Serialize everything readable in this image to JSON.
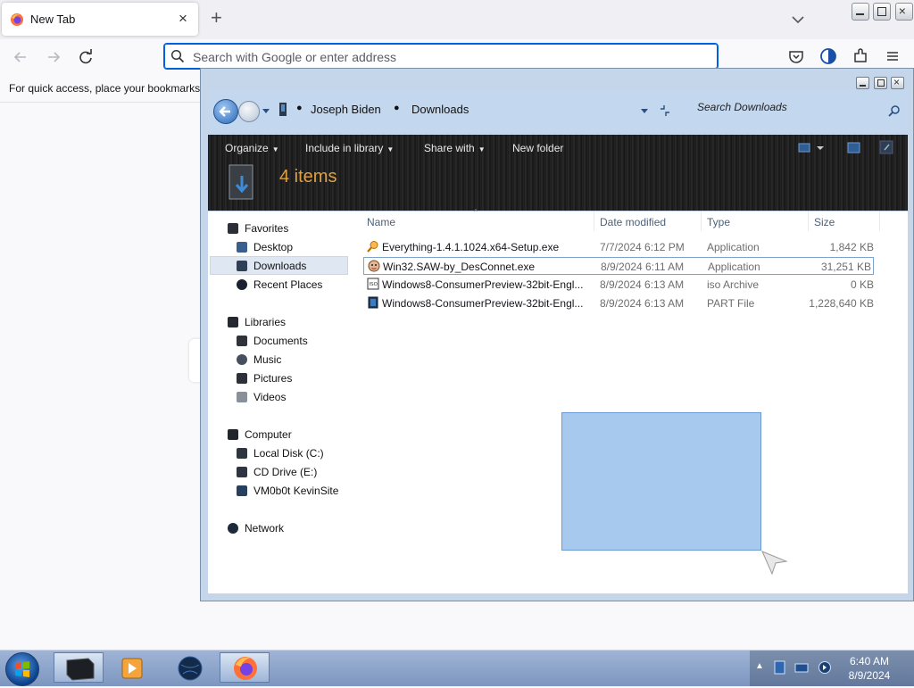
{
  "firefox": {
    "tab_title": "New Tab",
    "tab_close": "×",
    "new_tab": "+",
    "address_placeholder": "Search with Google or enter address",
    "bookmarks_hint": "For quick access, place your bookmarks l"
  },
  "explorer": {
    "breadcrumb": [
      "Joseph Biden",
      "Downloads"
    ],
    "search_placeholder": "Search Downloads",
    "toolbar": {
      "organize": "Organize",
      "include": "Include in library",
      "share": "Share with",
      "new_folder": "New folder"
    },
    "items_count": "4 items",
    "nav": {
      "favorites": "Favorites",
      "desktop": "Desktop",
      "downloads": "Downloads",
      "recent": "Recent Places",
      "libraries": "Libraries",
      "documents": "Documents",
      "music": "Music",
      "pictures": "Pictures",
      "videos": "Videos",
      "computer": "Computer",
      "local_disk": "Local Disk (C:)",
      "cd_drive": "CD Drive (E:)",
      "vm": "VM0b0t KevinSite",
      "network": "Network"
    },
    "columns": {
      "name": "Name",
      "date": "Date modified",
      "type": "Type",
      "size": "Size"
    },
    "files": [
      {
        "name": "Everything-1.4.1.1024.x64-Setup.exe",
        "date": "7/7/2024 6:12 PM",
        "type": "Application",
        "size": "1,842 KB",
        "icon": "search-app-icon"
      },
      {
        "name": "Win32.SAW-by_DesConnet.exe",
        "date": "8/9/2024 6:11 AM",
        "type": "Application",
        "size": "31,251 KB",
        "icon": "face-app-icon"
      },
      {
        "name": "Windows8-ConsumerPreview-32bit-Engl...",
        "date": "8/9/2024 6:13 AM",
        "type": "iso Archive",
        "size": "0 KB",
        "icon": "iso-file-icon"
      },
      {
        "name": "Windows8-ConsumerPreview-32bit-Engl...",
        "date": "8/9/2024 6:13 AM",
        "type": "PART File",
        "size": "1,228,640 KB",
        "icon": "part-file-icon"
      }
    ]
  },
  "taskbar": {
    "time": "6:40 AM",
    "date": "8/9/2024"
  }
}
